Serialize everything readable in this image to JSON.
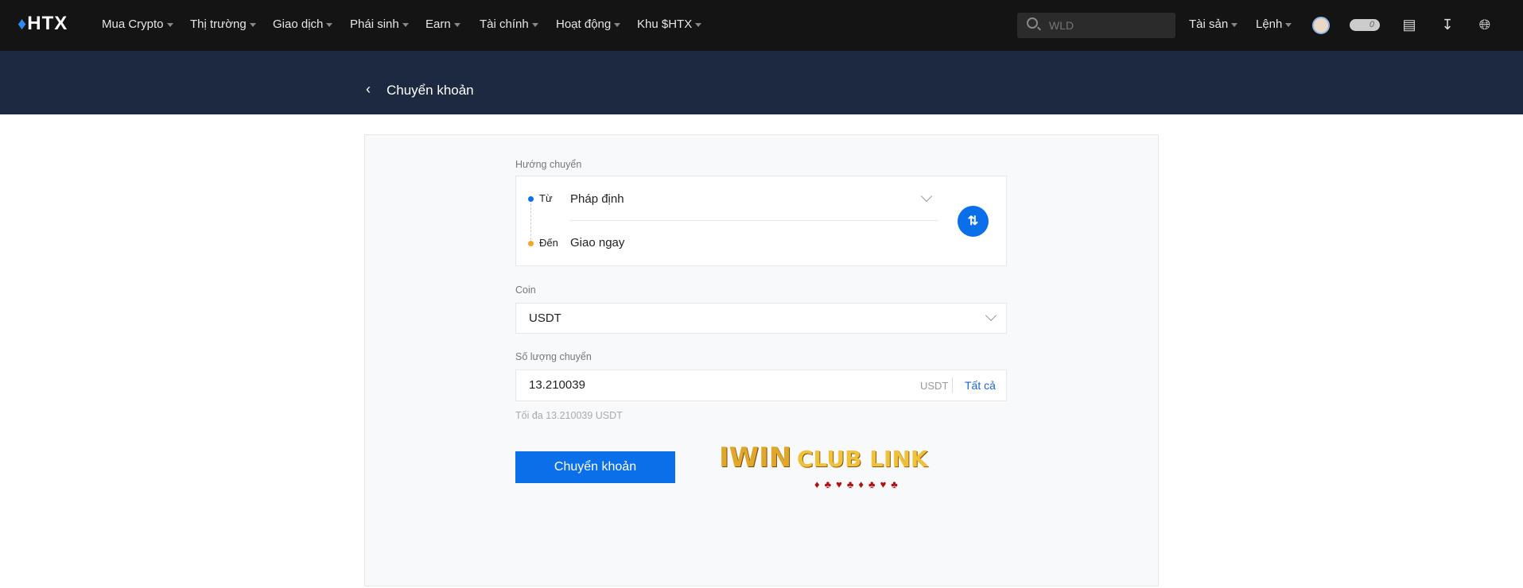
{
  "nav": {
    "logo": "HTX",
    "items": [
      "Mua Crypto",
      "Thị trường",
      "Giao dịch",
      "Phái sinh",
      "Earn",
      "Tài chính",
      "Hoạt động",
      "Khu $HTX"
    ],
    "search_placeholder": "WLD",
    "assets": "Tài sản",
    "orders": "Lệnh",
    "badge_count": "0",
    "icons": [
      "avatar",
      "toggle-badge",
      "orders-note-icon",
      "download-app-icon",
      "language-globe-icon"
    ]
  },
  "header": {
    "title": "Chuyển khoản"
  },
  "form": {
    "direction_label": "Hướng chuyển",
    "from_label": "Từ",
    "from_value": "Pháp định",
    "to_label": "Đến",
    "to_value": "Giao ngay",
    "coin_label": "Coin",
    "coin_value": "USDT",
    "amount_label": "Số lượng chuyển",
    "amount_value": "13.210039",
    "amount_unit": "USDT",
    "all_label": "Tất cả",
    "max_hint": "Tối đa 13.210039 USDT",
    "submit": "Chuyển khoản"
  },
  "watermark": {
    "text": "IWIN CLUB LINK"
  },
  "colors": {
    "accent": "#0a6fe8",
    "from_dot": "#0a6fe8",
    "to_dot": "#f5a623",
    "nav_bg": "#141414",
    "band_bg": "#1c2940"
  }
}
